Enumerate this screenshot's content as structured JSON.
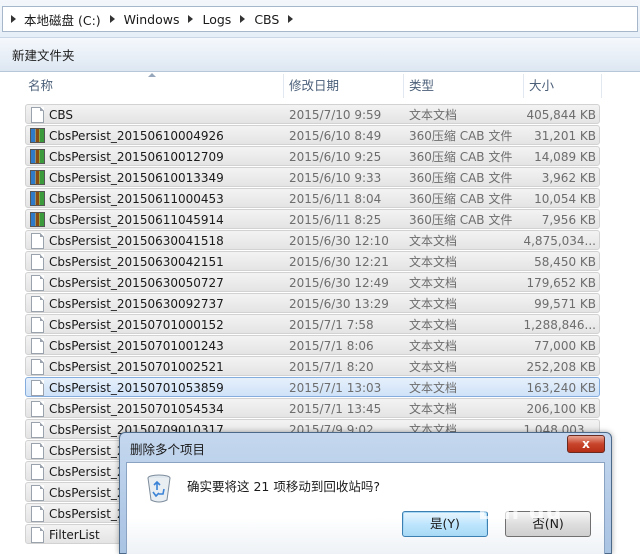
{
  "address": {
    "crumbs": [
      "本地磁盘 (C:)",
      "Windows",
      "Logs",
      "CBS"
    ]
  },
  "toolbar": {
    "new_folder": "新建文件夹"
  },
  "columns": {
    "name": "名称",
    "date": "修改日期",
    "type": "类型",
    "size": "大小"
  },
  "files": [
    {
      "name": "CBS",
      "date": "2015/7/10 9:59",
      "type": "文本文档",
      "size": "405,844 KB",
      "icon": "text-file-icon"
    },
    {
      "name": "CbsPersist_20150610004926",
      "date": "2015/6/10 8:49",
      "type": "360压缩 CAB 文件",
      "size": "31,201 KB",
      "icon": "cab-file-icon"
    },
    {
      "name": "CbsPersist_20150610012709",
      "date": "2015/6/10 9:25",
      "type": "360压缩 CAB 文件",
      "size": "14,089 KB",
      "icon": "cab-file-icon"
    },
    {
      "name": "CbsPersist_20150610013349",
      "date": "2015/6/10 9:33",
      "type": "360压缩 CAB 文件",
      "size": "3,962 KB",
      "icon": "cab-file-icon"
    },
    {
      "name": "CbsPersist_20150611000453",
      "date": "2015/6/11 8:04",
      "type": "360压缩 CAB 文件",
      "size": "10,054 KB",
      "icon": "cab-file-icon"
    },
    {
      "name": "CbsPersist_20150611045914",
      "date": "2015/6/11 8:25",
      "type": "360压缩 CAB 文件",
      "size": "7,956 KB",
      "icon": "cab-file-icon"
    },
    {
      "name": "CbsPersist_20150630041518",
      "date": "2015/6/30 12:10",
      "type": "文本文档",
      "size": "4,875,034...",
      "icon": "text-file-icon"
    },
    {
      "name": "CbsPersist_20150630042151",
      "date": "2015/6/30 12:21",
      "type": "文本文档",
      "size": "58,450 KB",
      "icon": "text-file-icon"
    },
    {
      "name": "CbsPersist_20150630050727",
      "date": "2015/6/30 12:49",
      "type": "文本文档",
      "size": "179,652 KB",
      "icon": "text-file-icon"
    },
    {
      "name": "CbsPersist_20150630092737",
      "date": "2015/6/30 13:29",
      "type": "文本文档",
      "size": "99,571 KB",
      "icon": "text-file-icon"
    },
    {
      "name": "CbsPersist_20150701000152",
      "date": "2015/7/1 7:58",
      "type": "文本文档",
      "size": "1,288,846...",
      "icon": "text-file-icon"
    },
    {
      "name": "CbsPersist_20150701001243",
      "date": "2015/7/1 8:06",
      "type": "文本文档",
      "size": "77,000 KB",
      "icon": "text-file-icon"
    },
    {
      "name": "CbsPersist_20150701002521",
      "date": "2015/7/1 8:20",
      "type": "文本文档",
      "size": "252,208 KB",
      "icon": "text-file-icon"
    },
    {
      "name": "CbsPersist_20150701053859",
      "date": "2015/7/1 13:03",
      "type": "文本文档",
      "size": "163,240 KB",
      "icon": "text-file-icon"
    },
    {
      "name": "CbsPersist_20150701054534",
      "date": "2015/7/1 13:45",
      "type": "文本文档",
      "size": "206,100 KB",
      "icon": "text-file-icon"
    },
    {
      "name": "CbsPersist_20150709010317",
      "date": "2015/7/9 9:02",
      "type": "文本文档",
      "size": "1,048,003...",
      "icon": "text-file-icon"
    },
    {
      "name": "CbsPersist_2",
      "date": "",
      "type": "",
      "size": "",
      "icon": "text-file-icon"
    },
    {
      "name": "CbsPersist_2",
      "date": "",
      "type": "",
      "size": "",
      "icon": "text-file-icon"
    },
    {
      "name": "CbsPersist_2",
      "date": "",
      "type": "",
      "size": "",
      "icon": "text-file-icon"
    },
    {
      "name": "CbsPersist_2",
      "date": "",
      "type": "",
      "size": "",
      "icon": "text-file-icon"
    },
    {
      "name": "FilterList",
      "date": "",
      "type": "",
      "size": "",
      "icon": "text-file-icon"
    }
  ],
  "dialog": {
    "title": "删除多个项目",
    "message": "确实要将这 21 项移动到回收站吗?",
    "yes": "是(Y)",
    "no": "否(N)",
    "close": "x"
  },
  "watermark": "Bai du"
}
